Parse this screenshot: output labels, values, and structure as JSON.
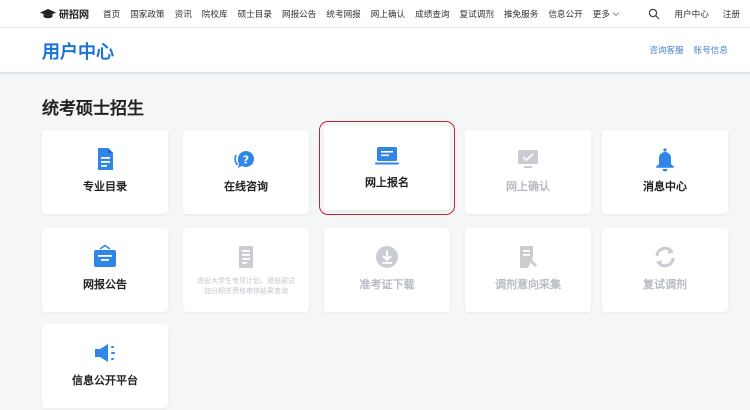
{
  "brand": {
    "name": "研招网"
  },
  "nav": {
    "items": [
      "首页",
      "国家政策",
      "资讯",
      "院校库",
      "硕士目录",
      "网报公告",
      "统考网报",
      "网上确认",
      "成绩查询",
      "复试调剂",
      "推免服务",
      "信息公开"
    ],
    "more_label": "更多",
    "user_center": "用户中心",
    "register": "注册"
  },
  "header": {
    "title": "用户中心",
    "links": [
      "咨询客服",
      "账号信息"
    ]
  },
  "section": {
    "title": "统考硕士招生"
  },
  "tiles": [
    {
      "label": "专业目录",
      "icon": "document-list-icon",
      "enabled": true
    },
    {
      "label": "在线咨询",
      "icon": "question-chat-icon",
      "enabled": true
    },
    {
      "label": "网上报名",
      "icon": "laptop-icon",
      "enabled": true,
      "highlighted": true
    },
    {
      "label": "网上确认",
      "icon": "confirm-screen-icon",
      "enabled": false
    },
    {
      "label": "消息中心",
      "icon": "bell-icon",
      "enabled": true
    },
    {
      "label": "网报公告",
      "icon": "notice-bag-icon",
      "enabled": true
    },
    {
      "label": "",
      "icon": "form-document-icon",
      "enabled": false,
      "description": "退役大学生专项计划、退役硕试\n加分相关资格审核结果查询"
    },
    {
      "label": "准考证下载",
      "icon": "download-circle-icon",
      "enabled": false
    },
    {
      "label": "调剂意向采集",
      "icon": "edit-document-icon",
      "enabled": false
    },
    {
      "label": "复试调剂",
      "icon": "refresh-icon",
      "enabled": false
    },
    {
      "label": "信息公开平台",
      "icon": "megaphone-icon",
      "enabled": true
    }
  ],
  "colors": {
    "accent": "#1a73d9",
    "icon_active": "#2f86e6",
    "icon_disabled": "#c9ccd1",
    "highlight_border": "#c8232c"
  }
}
